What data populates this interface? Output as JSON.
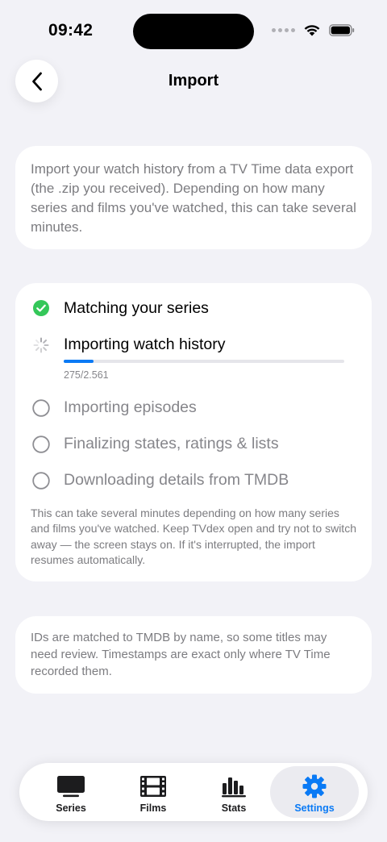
{
  "status_bar": {
    "time": "09:42"
  },
  "header": {
    "title": "Import"
  },
  "intro": {
    "text": "Import your watch history from a TV Time data export (the .zip you received). Depending on how many series and films you've watched, this can take several minutes."
  },
  "steps": [
    {
      "label": "Matching your series",
      "state": "done"
    },
    {
      "label": "Importing watch history",
      "state": "in-progress",
      "count": "275/2.561",
      "progress": 0.107
    },
    {
      "label": "Importing episodes",
      "state": "pending"
    },
    {
      "label": "Finalizing states, ratings & lists",
      "state": "pending"
    },
    {
      "label": "Downloading details from TMDB",
      "state": "pending"
    }
  ],
  "steps_note": "This can take several minutes depending on how many series and films you've watched. Keep TVdex open and try not to switch away — the screen stays on. If it's interrupted, the import resumes automatically.",
  "info": {
    "text": "IDs are matched to TMDB by name, so some titles may need review. Timestamps are exact only where TV Time recorded them."
  },
  "tabs": [
    {
      "label": "Series",
      "icon": "tv-icon"
    },
    {
      "label": "Films",
      "icon": "film-icon"
    },
    {
      "label": "Stats",
      "icon": "bar-chart-icon"
    },
    {
      "label": "Settings",
      "icon": "gear-icon",
      "selected": true
    }
  ],
  "colors": {
    "accent": "#0a7af5",
    "success": "#34c759",
    "background": "#f2f2f7"
  }
}
